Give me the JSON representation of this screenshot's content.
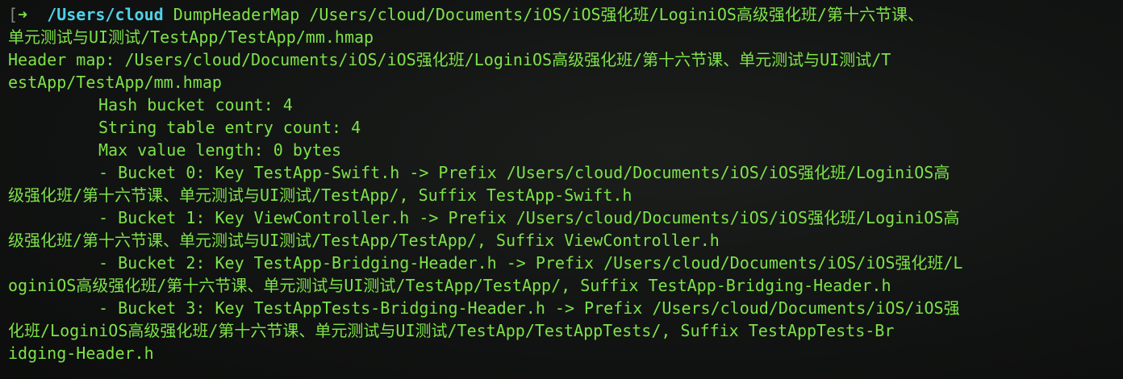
{
  "prompt": {
    "bracket": "[",
    "arrow": "➜",
    "cwd": "/Users/cloud"
  },
  "lines": [
    "DumpHeaderMap /Users/cloud/Documents/iOS/iOS强化班/LoginiOS高级强化班/第十六节课、",
    "单元测试与UI测试/TestApp/TestApp/mm.hmap",
    "Header map: /Users/cloud/Documents/iOS/iOS强化班/LoginiOS高级强化班/第十六节课、单元测试与UI测试/T",
    "estApp/TestApp/mm.hmap",
    "Hash bucket count: 4",
    "String table entry count: 4",
    "Max value length: 0 bytes",
    "- Bucket 0: Key TestApp-Swift.h -> Prefix /Users/cloud/Documents/iOS/iOS强化班/LoginiOS高",
    "级强化班/第十六节课、单元测试与UI测试/TestApp/, Suffix TestApp-Swift.h",
    "- Bucket 1: Key ViewController.h -> Prefix /Users/cloud/Documents/iOS/iOS强化班/LoginiOS高",
    "级强化班/第十六节课、单元测试与UI测试/TestApp/TestApp/, Suffix ViewController.h",
    "- Bucket 2: Key TestApp-Bridging-Header.h -> Prefix /Users/cloud/Documents/iOS/iOS强化班/L",
    "oginiOS高级强化班/第十六节课、单元测试与UI测试/TestApp/TestApp/, Suffix TestApp-Bridging-Header.h",
    "- Bucket 3: Key TestAppTests-Bridging-Header.h -> Prefix /Users/cloud/Documents/iOS/iOS强",
    "化班/LoginiOS高级强化班/第十六节课、单元测试与UI测试/TestApp/TestAppTests/, Suffix TestAppTests-Br",
    "idging-Header.h"
  ],
  "colors": {
    "output": "#7ee24a",
    "cwd": "#4fd2e8",
    "bracket": "#7f8a7c",
    "background": "#121413"
  }
}
